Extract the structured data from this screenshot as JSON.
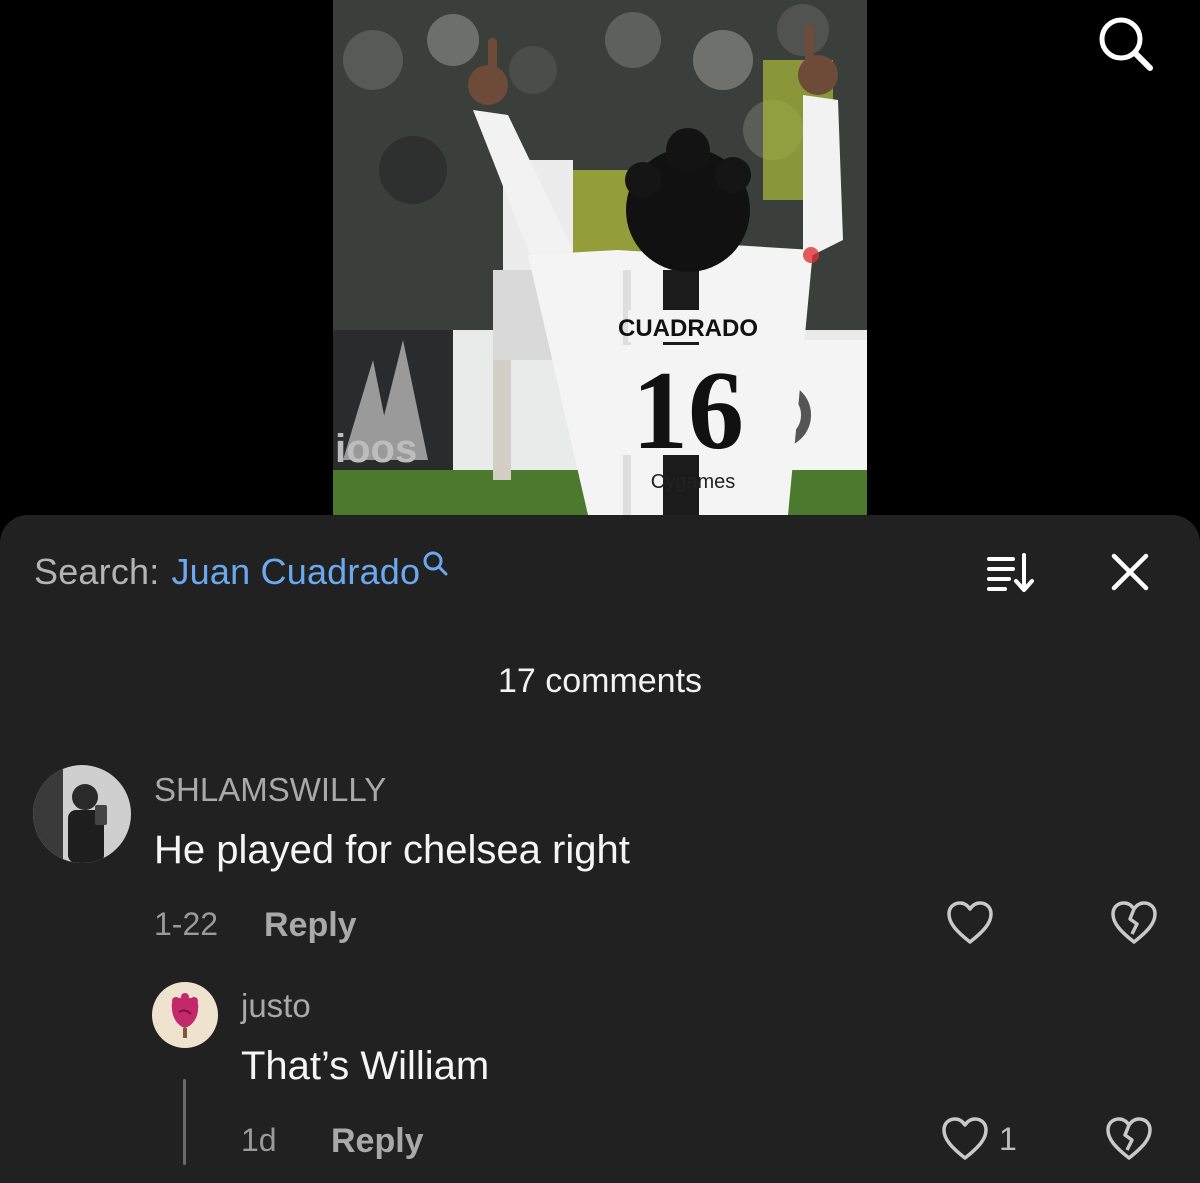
{
  "top_bar": {
    "search_icon": "search-icon"
  },
  "video": {
    "player_name": "CUADRADO",
    "player_number": "16",
    "sponsor": "Cygames"
  },
  "comments_panel": {
    "search_prefix": "Search:",
    "search_term": "Juan Cuadrado",
    "search_term_icon": "search-icon",
    "sort_icon": "sort-icon",
    "close_icon": "close-icon",
    "count_label": "17 comments",
    "comments": [
      {
        "username": "SHLAMSWILLY",
        "text": "He played for chelsea right",
        "date": "1-22",
        "reply_label": "Reply",
        "like_icon": "heart-outline-icon",
        "dislike_icon": "broken-heart-icon",
        "replies": [
          {
            "username": "justo",
            "text": "That’s William",
            "date": "1d",
            "reply_label": "Reply",
            "like_icon": "heart-outline-icon",
            "like_count": "1",
            "dislike_icon": "broken-heart-icon"
          }
        ]
      }
    ]
  },
  "colors": {
    "sheet_bg": "#212121",
    "accent_link": "#6aa9f0",
    "muted_text": "#a9a9a9"
  }
}
